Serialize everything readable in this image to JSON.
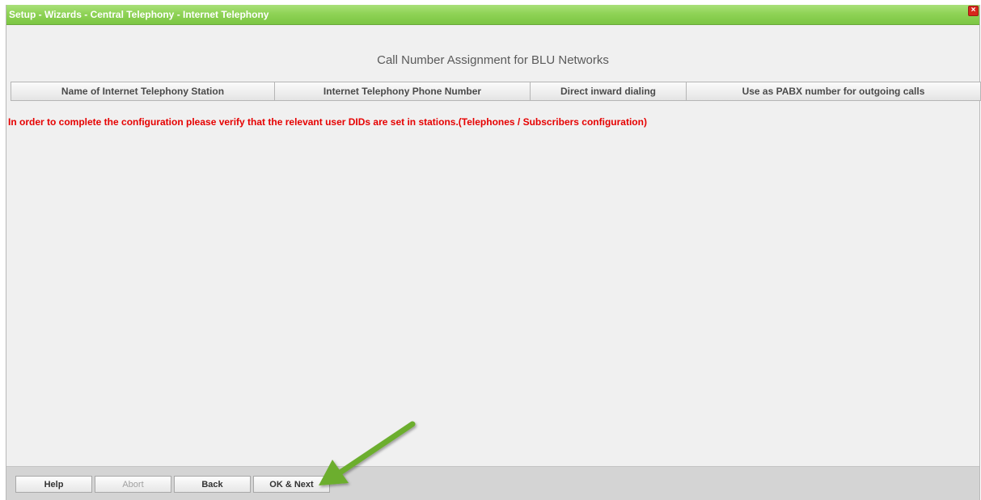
{
  "window": {
    "title": "Setup - Wizards - Central Telephony - Internet Telephony",
    "close_glyph": "×"
  },
  "main": {
    "heading": "Call Number Assignment for BLU Networks",
    "table": {
      "columns": [
        "Name of Internet Telephony Station",
        "Internet Telephony Phone Number",
        "Direct inward dialing",
        "Use as PABX number for outgoing calls"
      ]
    },
    "warning": "In order to complete the configuration please verify that the relevant user DIDs are set in stations.(Telephones / Subscribers configuration)"
  },
  "footer": {
    "buttons": {
      "help": "Help",
      "abort": "Abort",
      "back": "Back",
      "ok_next": "OK & Next"
    }
  },
  "colors": {
    "title_bar": "#8fd356",
    "warning_text": "#e60000",
    "annotation_arrow": "#6cae2f"
  },
  "icons": {
    "close": "close-icon",
    "annotation": "green-arrow-icon"
  }
}
